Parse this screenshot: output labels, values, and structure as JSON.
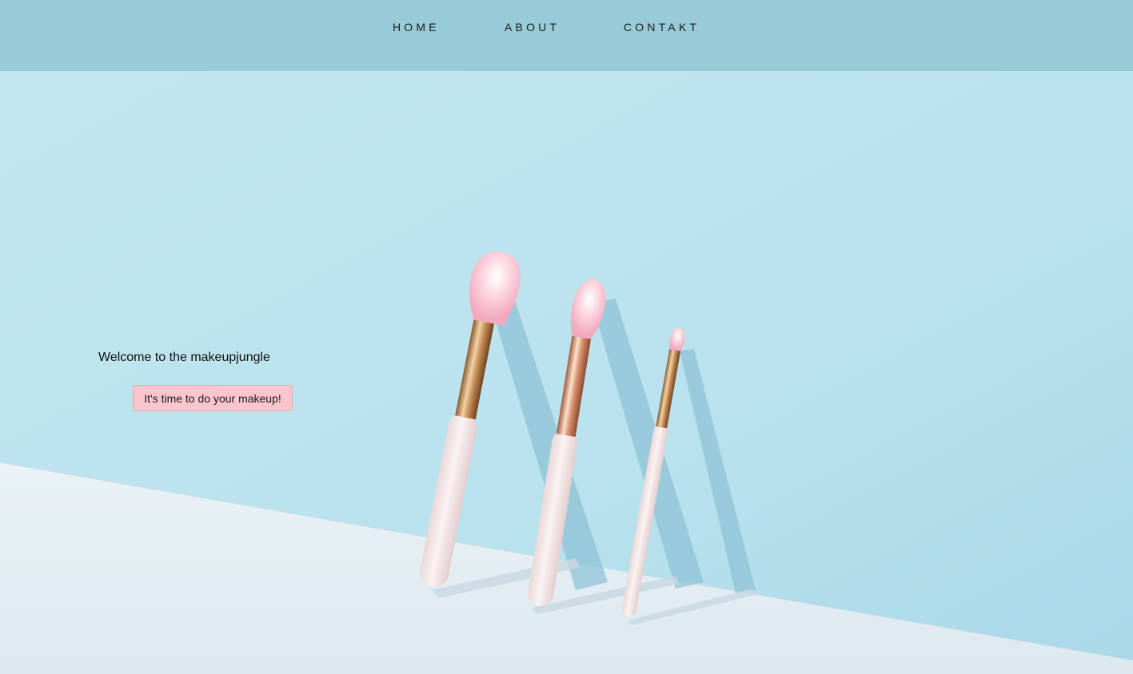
{
  "nav": {
    "items": [
      {
        "label": "HOME"
      },
      {
        "label": "ABOUT"
      },
      {
        "label": "CONTAKT"
      }
    ]
  },
  "hero": {
    "welcome_text": "Welcome to the makeupjungle",
    "cta_label": "It's time to do your makeup!"
  },
  "colors": {
    "nav_background": "#98cbd8",
    "wall": "#bde3ee",
    "floor": "#e3ecf2",
    "button": "#f9c5cf"
  }
}
